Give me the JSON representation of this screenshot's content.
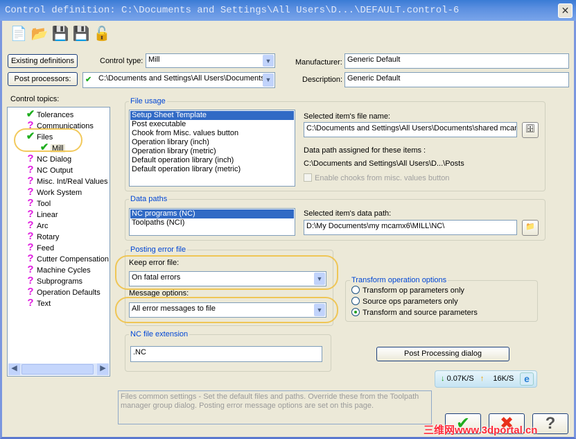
{
  "window": {
    "title": "Control definition: C:\\Documents and Settings\\All Users\\D...\\DEFAULT.control-6",
    "close": "✕"
  },
  "toolbar": [
    {
      "icon": "new-file-icon",
      "glyph": "📄"
    },
    {
      "icon": "open-folder-icon",
      "glyph": "📂"
    },
    {
      "icon": "save-icon",
      "glyph": "💾"
    },
    {
      "icon": "save-as-icon",
      "glyph": "💾"
    },
    {
      "icon": "unlock-icon",
      "glyph": "🔓"
    }
  ],
  "top": {
    "existing_label": "Existing definitions",
    "post_label": "Post processors:",
    "control_type_label": "Control type:",
    "control_type_value": "Mill",
    "post_path": "C:\\Documents and Settings\\All Users\\Documents",
    "manufacturer_label": "Manufacturer:",
    "manufacturer_value": "Generic Default",
    "description_label": "Description:",
    "description_value": "Generic Default"
  },
  "tree": {
    "label": "Control topics:",
    "items": [
      {
        "label": "Tolerances",
        "status": "check"
      },
      {
        "label": "Communications",
        "status": "question"
      },
      {
        "label": "Files",
        "status": "check"
      },
      {
        "label": "Mill",
        "status": "check",
        "child": true
      },
      {
        "label": "NC Dialog",
        "status": "question"
      },
      {
        "label": "NC Output",
        "status": "question"
      },
      {
        "label": "Misc. Int/Real Values",
        "status": "question"
      },
      {
        "label": "Work System",
        "status": "question"
      },
      {
        "label": "Tool",
        "status": "question"
      },
      {
        "label": "Linear",
        "status": "question"
      },
      {
        "label": "Arc",
        "status": "question"
      },
      {
        "label": "Rotary",
        "status": "question"
      },
      {
        "label": "Feed",
        "status": "question"
      },
      {
        "label": "Cutter Compensation",
        "status": "question"
      },
      {
        "label": "Machine Cycles",
        "status": "question"
      },
      {
        "label": "Subprograms",
        "status": "question"
      },
      {
        "label": "Operation Defaults",
        "status": "question"
      },
      {
        "label": "Text",
        "status": "question"
      }
    ]
  },
  "file_usage": {
    "label": "File usage",
    "items": [
      "Setup Sheet Template",
      "Post executable",
      "Chook from Misc. values button",
      "Operation library (inch)",
      "Operation library (metric)",
      "Default operation library (inch)",
      "Default operation library (metric)"
    ],
    "selected": 0,
    "file_name_label": "Selected item's file name:",
    "file_name_value": "C:\\Documents and Settings\\All Users\\Documents\\shared mcam",
    "data_path_label": "Data path assigned for these items :",
    "data_path_value": "C:\\Documents and Settings\\All Users\\D...\\Posts",
    "enable_chooks": "Enable chooks from misc. values button"
  },
  "data_paths": {
    "label": "Data paths",
    "items": [
      "NC programs (NC)",
      "Toolpaths (NCI)"
    ],
    "selected": 0,
    "path_label": "Selected item's data path:",
    "path_value": "D:\\My Documents\\my mcamx6\\MILL\\NC\\"
  },
  "posting_error": {
    "label": "Posting error file",
    "keep_label": "Keep error file:",
    "keep_value": "On fatal errors",
    "msg_label": "Message options:",
    "msg_value": "All error messages to file"
  },
  "transform": {
    "label": "Transform operation options",
    "options": [
      "Transform op parameters only",
      "Source ops parameters only",
      "Transform and source parameters"
    ],
    "selected": 2
  },
  "nc_ext": {
    "label": "NC file extension",
    "value": ".NC"
  },
  "post_dialog_button": "Post Processing dialog",
  "netspeed": {
    "down": "0.07K/S",
    "up": "16K/S"
  },
  "help_text": "Files common settings - Set the default files and paths.  Override these from the Toolpath manager group dialog.  Posting error message options are set on this page.",
  "watermark": "三维网www.3dportal.cn"
}
